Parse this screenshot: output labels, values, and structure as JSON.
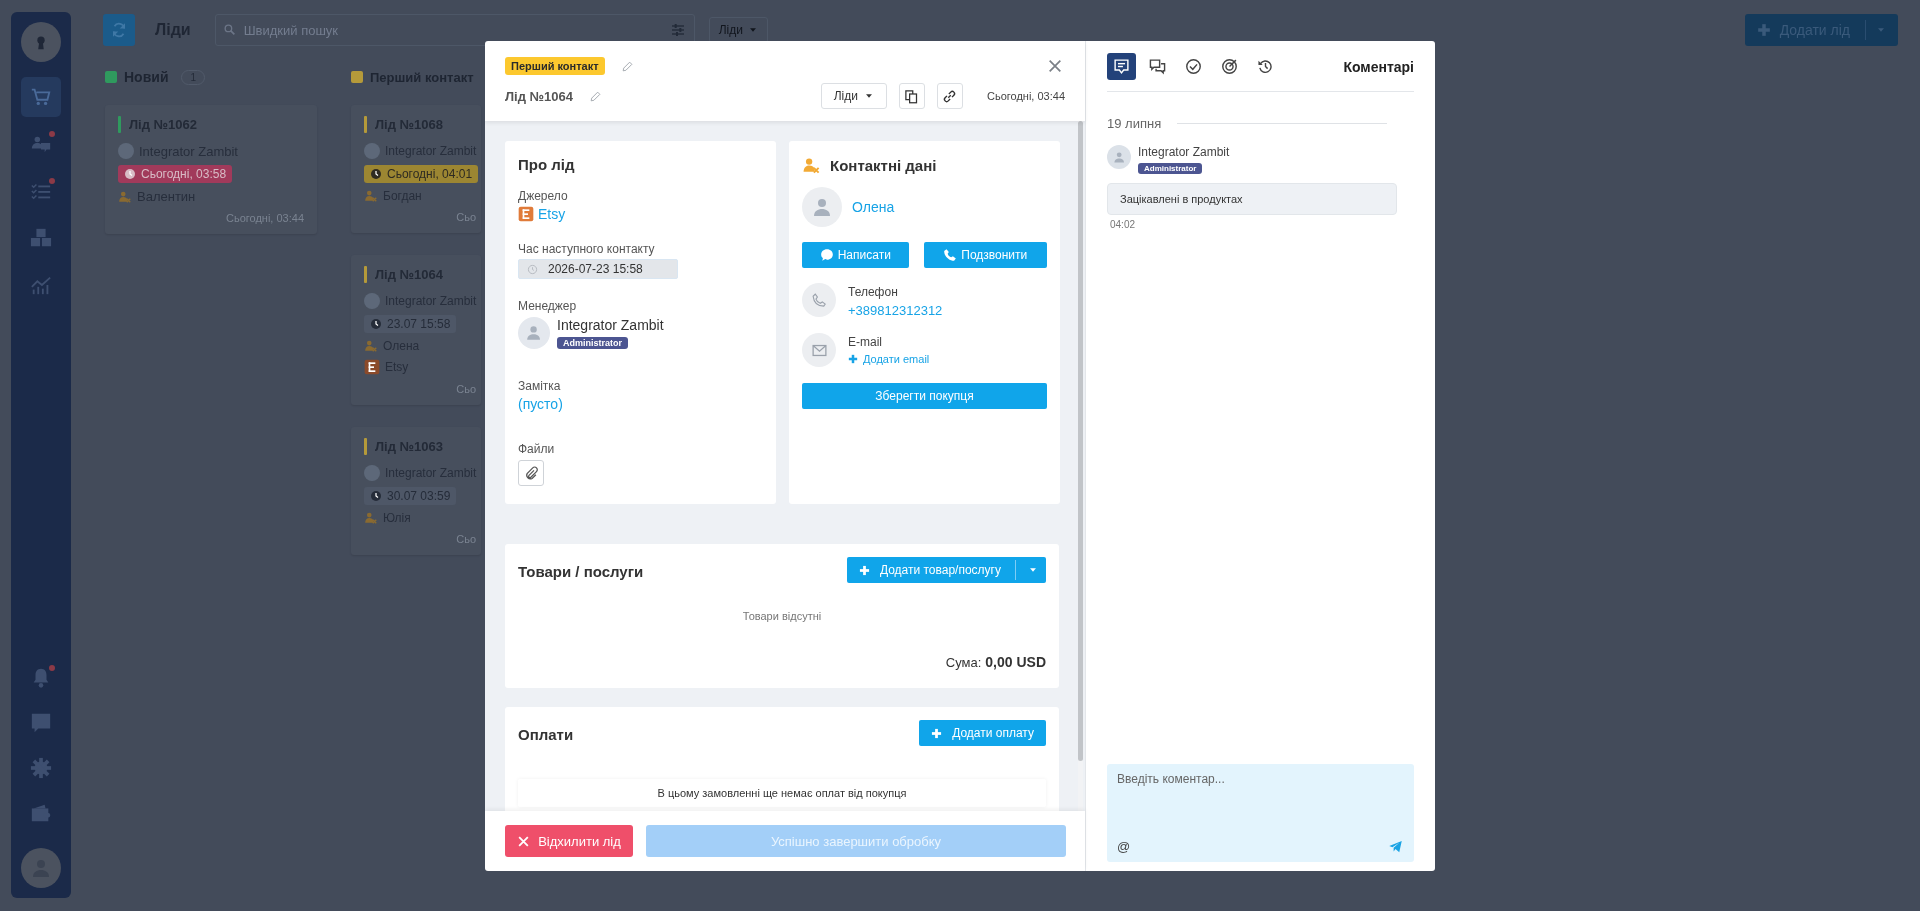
{
  "sidebar": {
    "items": [
      {
        "kind": "cart",
        "selected": true,
        "notification": false
      },
      {
        "kind": "chat",
        "selected": false,
        "notification": true
      },
      {
        "kind": "tasks",
        "selected": false,
        "notification": true
      },
      {
        "kind": "boxes",
        "selected": false,
        "notification": false
      },
      {
        "kind": "chart",
        "selected": false,
        "notification": false
      }
    ],
    "bottom_items": [
      {
        "kind": "bell",
        "notification": true
      },
      {
        "kind": "help",
        "notification": false
      },
      {
        "kind": "gear",
        "notification": false
      },
      {
        "kind": "wallet",
        "notification": false
      }
    ]
  },
  "toolbar": {
    "title": "Ліди",
    "search": {
      "placeholder": "Швидкий пошук"
    },
    "view_dropdown": "Ліди",
    "add_button": "Додати лід"
  },
  "board": {
    "columns": [
      {
        "title": "Новий",
        "color": "#2f9a5e",
        "count": "1",
        "cards": [
          {
            "title": "Лід №1062",
            "manager": "Integrator Zambit",
            "due": {
              "text": "Сьогодні, 03:58",
              "kind": "overdue"
            },
            "contact": "Валентин",
            "created": "Сьогодні, 03:44"
          }
        ]
      },
      {
        "title": "Перший контакт",
        "color": "#b59a3a",
        "cards": [
          {
            "title": "Лід №1068",
            "manager": "Integrator Zambit",
            "due": {
              "text": "Сьогодні, 04:01",
              "kind": "today"
            },
            "contact": "Богдан",
            "created": "Сьо"
          },
          {
            "title": "Лід №1064",
            "manager": "Integrator Zambit",
            "due": {
              "text": "23.07 15:58",
              "kind": "future"
            },
            "contact": "Олена",
            "source": "Etsy",
            "created": "Сьо"
          },
          {
            "title": "Лід №1063",
            "manager": "Integrator Zambit",
            "due": {
              "text": "30.07 03:59",
              "kind": "future"
            },
            "contact": "Юлія",
            "created": "Сьо"
          }
        ]
      }
    ]
  },
  "lead": {
    "stage_badge": "Перший контакт",
    "title": "Лід №1064",
    "pipeline": "Ліди",
    "date": "Сьогодні, 03:44",
    "about": {
      "title": "Про лід",
      "source_label": "Джерело",
      "source": "Etsy",
      "next_contact_label": "Час наступного контакту",
      "next_contact": "2026-07-23 15:58",
      "manager_label": "Менеджер",
      "manager": {
        "name": "Integrator Zambit",
        "role": "Administrator"
      },
      "note_label": "Замітка",
      "note": "(пусто)",
      "files_label": "Файли"
    },
    "contact": {
      "title": "Контактні дані",
      "name": "Олена",
      "write_button": "Написати",
      "call_button": "Подзвонити",
      "phone_label": "Телефон",
      "phone": "+389812312312",
      "email_label": "E-mail",
      "add_email": "Додати email",
      "save_button": "Зберегти покупця"
    },
    "products": {
      "title": "Товари / послуги",
      "add_button": "Додати товар/послугу",
      "empty": "Товари відсутні",
      "total_label": "Сума:",
      "total": "0,00 USD"
    },
    "payments": {
      "title": "Оплати",
      "add_button": "Додати оплату",
      "empty": "В цьому замовленні ще немає оплат від покупця"
    },
    "footer": {
      "reject_button": "Відхилити лід",
      "complete_button": {
        "label": "Успішно завершити обробку",
        "disabled": true
      }
    }
  },
  "comments_panel": {
    "tabs": [
      {
        "kind": "comments",
        "selected": true
      },
      {
        "kind": "chats",
        "selected": false
      },
      {
        "kind": "tasks",
        "selected": false
      },
      {
        "kind": "goals",
        "selected": false
      },
      {
        "kind": "history",
        "selected": false
      }
    ],
    "title": "Коментарі",
    "groups": [
      {
        "date": "19 липня",
        "comments": [
          {
            "author": "Integrator Zambit",
            "role": "Administrator",
            "text": "Зацікавлені в продуктах",
            "time": "04:02"
          }
        ]
      }
    ],
    "input": {
      "placeholder": "Введіть коментар...",
      "mention_button": "@"
    }
  }
}
